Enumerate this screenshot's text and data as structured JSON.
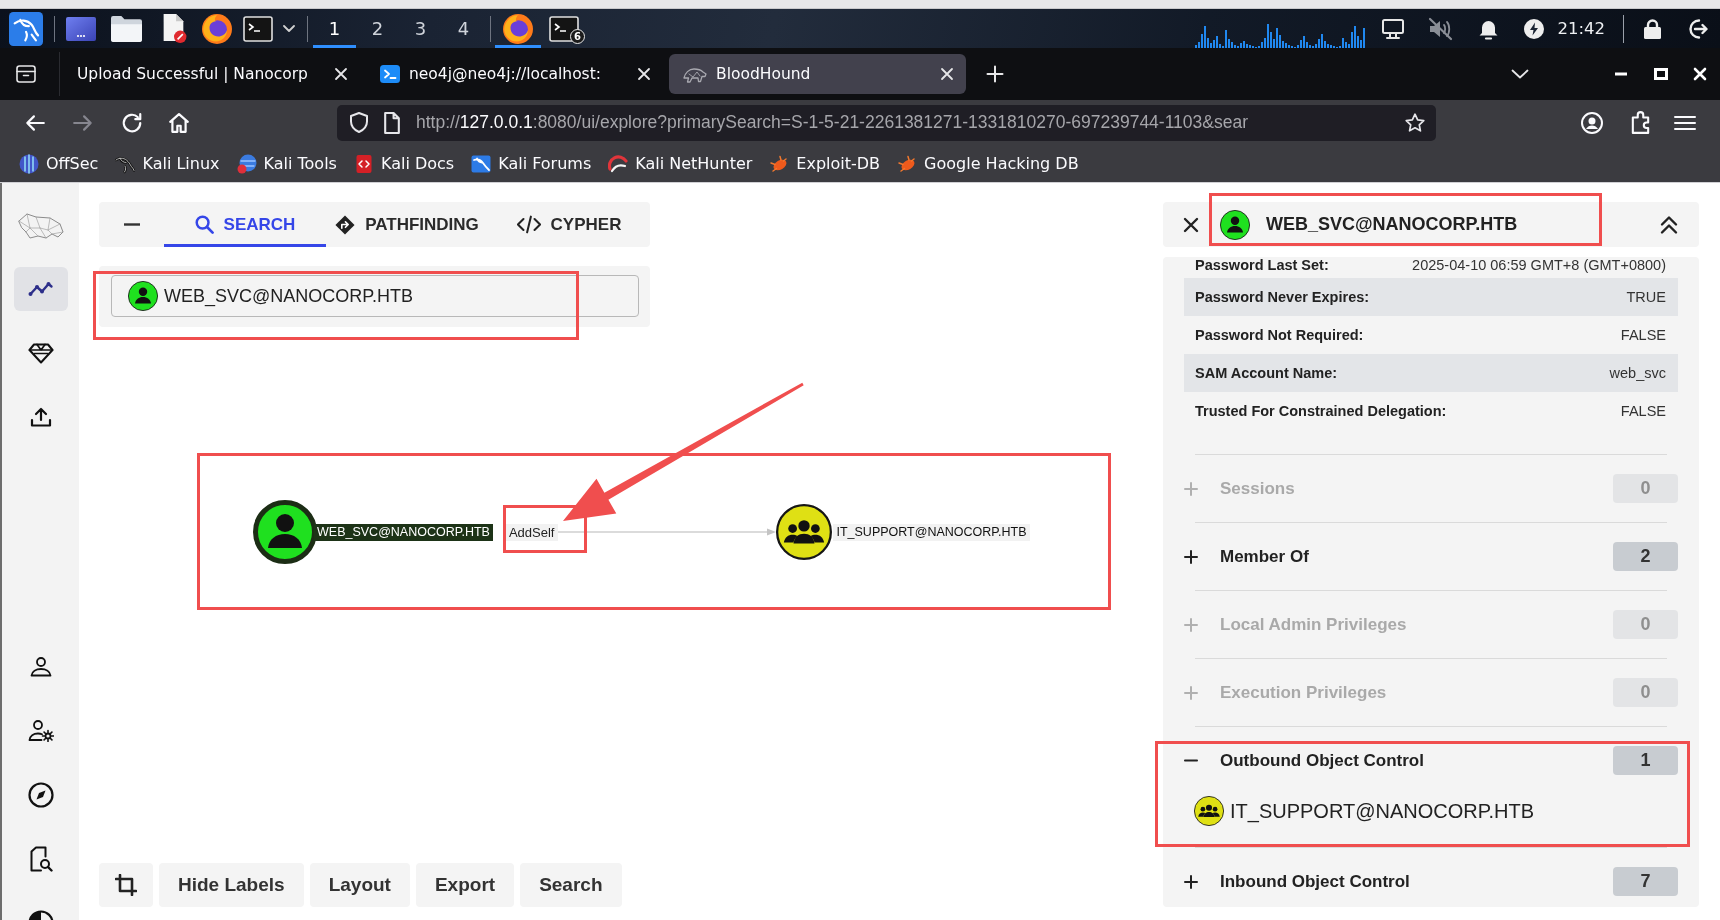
{
  "taskbar": {
    "launchers": [
      {
        "kind": "dragon"
      },
      {
        "kind": "desktop"
      },
      {
        "kind": "files"
      },
      {
        "kind": "editor"
      },
      {
        "kind": "browser"
      },
      {
        "kind": "terminal"
      },
      {
        "kind": "caret"
      }
    ],
    "workspaces": [
      {
        "label": "1",
        "selected": true
      },
      {
        "label": "2",
        "selected": false
      },
      {
        "label": "3",
        "selected": false
      },
      {
        "label": "4",
        "selected": false
      }
    ],
    "windows": [
      {
        "kind": "browser",
        "active": true
      },
      {
        "kind": "terminal",
        "active": false,
        "badge": "6"
      }
    ],
    "tray": [
      {
        "kind": "network"
      },
      {
        "kind": "muted"
      },
      {
        "kind": "bell"
      },
      {
        "kind": "power"
      }
    ],
    "clock": "21:42"
  },
  "browser": {
    "tabs": [
      {
        "title": "Upload Successful | Nanocorp",
        "kind": "page",
        "selected": false
      },
      {
        "title": "neo4j@neo4j://localhost:",
        "kind": "terminal",
        "selected": false
      },
      {
        "title": "BloodHound",
        "kind": "hound",
        "selected": true
      }
    ],
    "nav_buttons": [
      {
        "kind": "back",
        "disabled": false
      },
      {
        "kind": "forward",
        "disabled": true
      },
      {
        "kind": "reload",
        "disabled": false
      },
      {
        "kind": "home",
        "disabled": false
      }
    ],
    "url": {
      "scheme": "http://",
      "host": "127.0.0.1",
      "rest": ":8080/ui/explore?primarySearch=S-1-5-21-2261381271-1331810270-697239744-1103&sear"
    },
    "bookmarks": [
      {
        "label": "OffSec",
        "kind": "offsec"
      },
      {
        "label": "Kali Linux",
        "kind": "kali"
      },
      {
        "label": "Kali Tools",
        "kind": "tools"
      },
      {
        "label": "Kali Docs",
        "kind": "docs"
      },
      {
        "label": "Kali Forums",
        "kind": "forums"
      },
      {
        "label": "Kali NetHunter",
        "kind": "nethunter"
      },
      {
        "label": "Exploit-DB",
        "kind": "bug"
      },
      {
        "label": "Google Hacking DB",
        "kind": "bug"
      }
    ]
  },
  "sidebar": {
    "top_items": [
      {
        "kind": "explore",
        "selected": true
      },
      {
        "kind": "zones",
        "selected": false
      },
      {
        "kind": "upload",
        "selected": false
      }
    ],
    "bottom_items": [
      {
        "kind": "profile",
        "selected": false
      },
      {
        "kind": "admin",
        "selected": false
      },
      {
        "kind": "compass",
        "selected": false
      },
      {
        "kind": "docs",
        "selected": false
      },
      {
        "kind": "theme",
        "selected": false
      }
    ]
  },
  "search_panel": {
    "tabs": [
      {
        "label": "SEARCH",
        "kind": "search",
        "selected": true
      },
      {
        "label": "PATHFINDING",
        "kind": "pathfinding",
        "selected": false
      },
      {
        "label": "CYPHER",
        "kind": "cypher",
        "selected": false
      }
    ],
    "query": {
      "value": "WEB_SVC@NANOCORP.HTB",
      "kind": "user"
    }
  },
  "graph": {
    "nodes": [
      {
        "label": "WEB_SVC@NANOCORP.HTB",
        "kind": "user",
        "selected": true
      },
      {
        "label": "IT_SUPPORT@NANOCORP.HTB",
        "kind": "group",
        "selected": false
      }
    ],
    "edges": [
      {
        "label": "AddSelf"
      }
    ]
  },
  "graph_toolbar": {
    "buttons": [
      {
        "kind": "crop"
      },
      {
        "kind": "text",
        "label": "Hide Labels"
      },
      {
        "kind": "text",
        "label": "Layout"
      },
      {
        "kind": "text",
        "label": "Export"
      },
      {
        "kind": "text",
        "label": "Search"
      }
    ]
  },
  "entity_panel": {
    "title": "WEB_SVC@NANOCORP.HTB",
    "kind": "user",
    "properties": [
      {
        "label": "Password Last Set:",
        "value": "2025-04-10 06:59 GMT+8 (GMT+0800)"
      },
      {
        "label": "Password Never Expires:",
        "value": "TRUE"
      },
      {
        "label": "Password Not Required:",
        "value": "FALSE"
      },
      {
        "label": "SAM Account Name:",
        "value": "web_svc"
      },
      {
        "label": "Trusted For Constrained Delegation:",
        "value": "FALSE"
      }
    ],
    "sections": [
      {
        "label": "Sessions",
        "count": "0",
        "disabled": true,
        "expanded": false
      },
      {
        "label": "Member Of",
        "count": "2",
        "disabled": false,
        "expanded": false
      },
      {
        "label": "Local Admin Privileges",
        "count": "0",
        "disabled": true,
        "expanded": false
      },
      {
        "label": "Execution Privileges",
        "count": "0",
        "disabled": true,
        "expanded": false
      },
      {
        "label": "Outbound Object Control",
        "count": "1",
        "disabled": false,
        "expanded": true,
        "children": [
          {
            "label": "IT_SUPPORT@NANOCORP.HTB",
            "kind": "group"
          }
        ]
      },
      {
        "label": "Inbound Object Control",
        "count": "7",
        "disabled": false,
        "expanded": false
      }
    ]
  },
  "annotations": [
    {
      "kind": "rectangle"
    },
    {
      "kind": "rectangle"
    },
    {
      "kind": "arrow"
    },
    {
      "kind": "rectangle"
    },
    {
      "kind": "rectangle"
    },
    {
      "kind": "rectangle"
    }
  ]
}
